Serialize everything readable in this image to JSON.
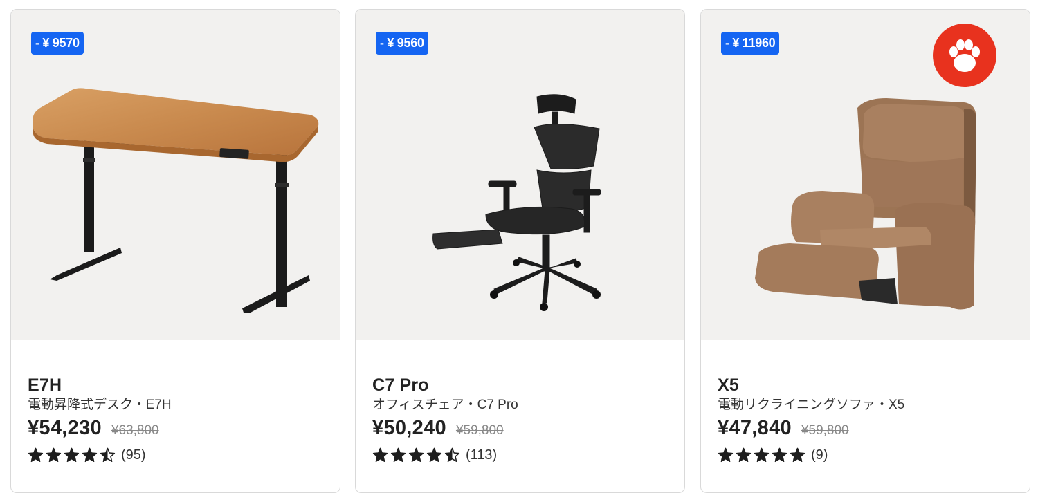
{
  "products": [
    {
      "discount_badge": "- ¥ 9570",
      "name": "E7H",
      "subtitle": "電動昇降式デスク・E7H",
      "price": "¥54,230",
      "old_price": "¥63,800",
      "rating": 4.5,
      "review_count": "(95)",
      "image_icon": "standing-desk",
      "has_paw_badge": false
    },
    {
      "discount_badge": "- ¥ 9560",
      "name": "C7 Pro",
      "subtitle": "オフィスチェア・C7 Pro",
      "price": "¥50,240",
      "old_price": "¥59,800",
      "rating": 4.5,
      "review_count": "(113)",
      "image_icon": "office-chair",
      "has_paw_badge": false
    },
    {
      "discount_badge": "- ¥ 11960",
      "name": "X5",
      "subtitle": "電動リクライニングソファ・X5",
      "price": "¥47,840",
      "old_price": "¥59,800",
      "rating": 5,
      "review_count": "(9)",
      "image_icon": "recliner-sofa",
      "has_paw_badge": true
    }
  ],
  "colors": {
    "badge": "#1565f2",
    "paw_badge": "#e8321e",
    "image_bg": "#f2f1ef"
  }
}
